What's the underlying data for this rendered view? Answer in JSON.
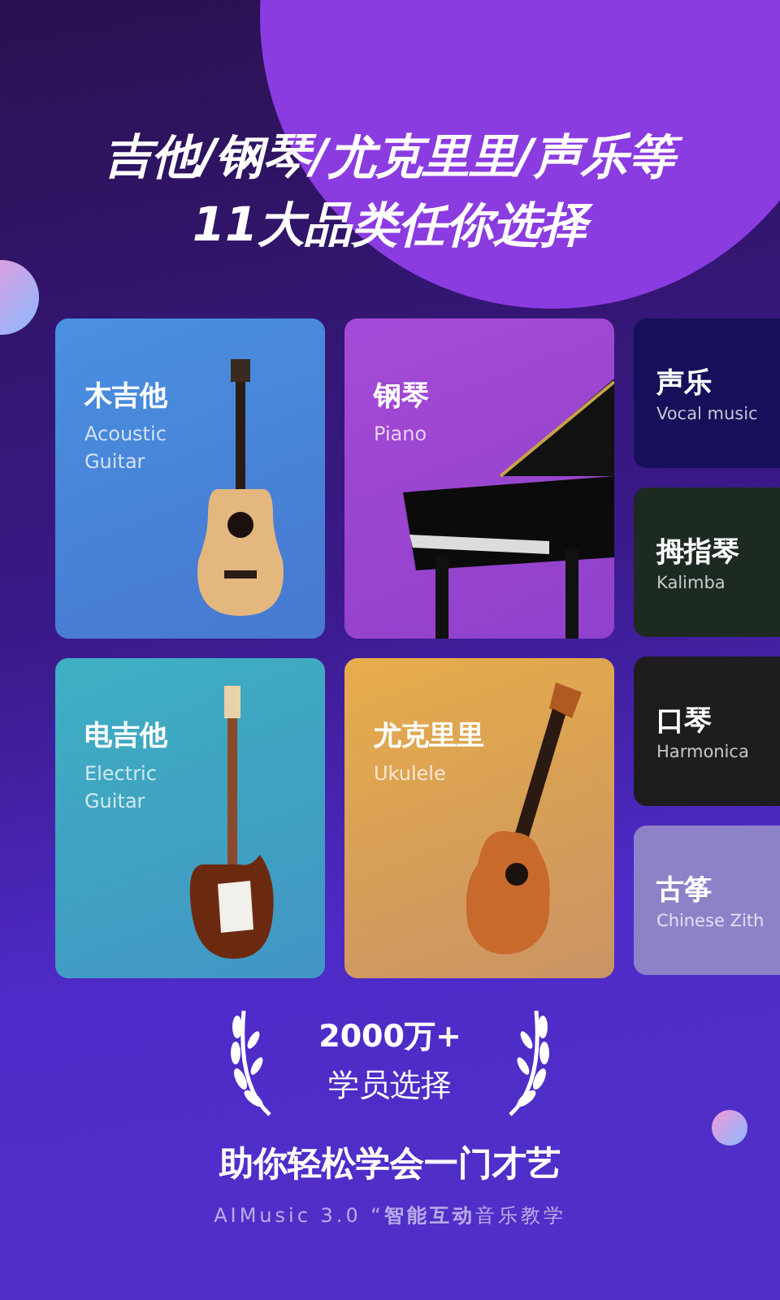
{
  "headline": [
    "吉他/钢琴/尤克里里/声乐等",
    "11大品类任你选择"
  ],
  "cards": [
    {
      "kind": "acoustic",
      "title": "木吉他",
      "subtitle": "Acoustic Guitar",
      "color": "#4a90e2"
    },
    {
      "kind": "piano",
      "title": "钢琴",
      "subtitle": "Piano",
      "color": "#a54ad8"
    },
    {
      "kind": "electric",
      "title": "电吉他",
      "subtitle": "Electric Guitar",
      "color": "#3fb0c4"
    },
    {
      "kind": "ukulele",
      "title": "尤克里里",
      "subtitle": "Ukulele",
      "color": "#e8ad4c"
    }
  ],
  "side_cards": [
    {
      "title": "声乐",
      "subtitle": "Vocal music",
      "color": "#16105a"
    },
    {
      "title": "拇指琴",
      "subtitle": "Kalimba",
      "color": "#1d2a22"
    },
    {
      "title": "口琴",
      "subtitle": "Harmonica",
      "color": "#1e1c1f"
    },
    {
      "title": "古筝",
      "subtitle": "Chinese Zith",
      "color": "#8d82c8"
    }
  ],
  "stat": {
    "value": "2000万+",
    "label": "学员选择"
  },
  "tagline": "助你轻松学会一门才艺",
  "subline": "AIMusic 3.0 “**智能互动**音乐教学"
}
